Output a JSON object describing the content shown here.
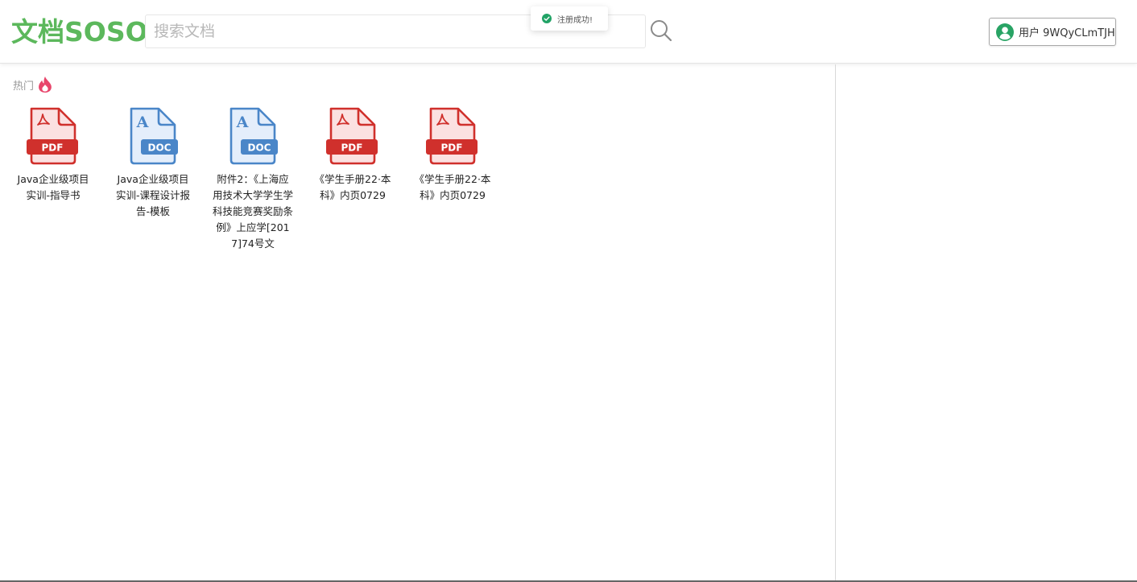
{
  "header": {
    "logo": "文档SOSO",
    "search_placeholder": "搜索文档",
    "search_value": "",
    "user_label": "用户 9WQyCLmTJH"
  },
  "toast": {
    "message": "注册成功!"
  },
  "hot": {
    "title": "热门",
    "items": [
      {
        "type": "PDF",
        "title": "Java企业级项目实训-指导书"
      },
      {
        "type": "DOC",
        "title": "Java企业级项目实训-课程设计报告-模板"
      },
      {
        "type": "DOC",
        "title": "附件2：《上海应用技术大学学生学科技能竞赛奖励条例》上应学[2017]74号文"
      },
      {
        "type": "PDF",
        "title": "《学生手册22·本科》内页0729"
      },
      {
        "type": "PDF",
        "title": "《学生手册22·本科》内页0729"
      }
    ]
  },
  "colors": {
    "brand_green": "#5cb85c",
    "pdf_red": "#d0302c",
    "doc_blue": "#4a86c8",
    "fire_pink": "#e8456b",
    "success_green": "#21a366"
  },
  "icons": {
    "search": "search-icon",
    "user": "user-avatar-icon",
    "toast": "check-circle-icon",
    "hot": "fire-icon",
    "pdf": "pdf-file-icon",
    "doc": "doc-file-icon"
  }
}
